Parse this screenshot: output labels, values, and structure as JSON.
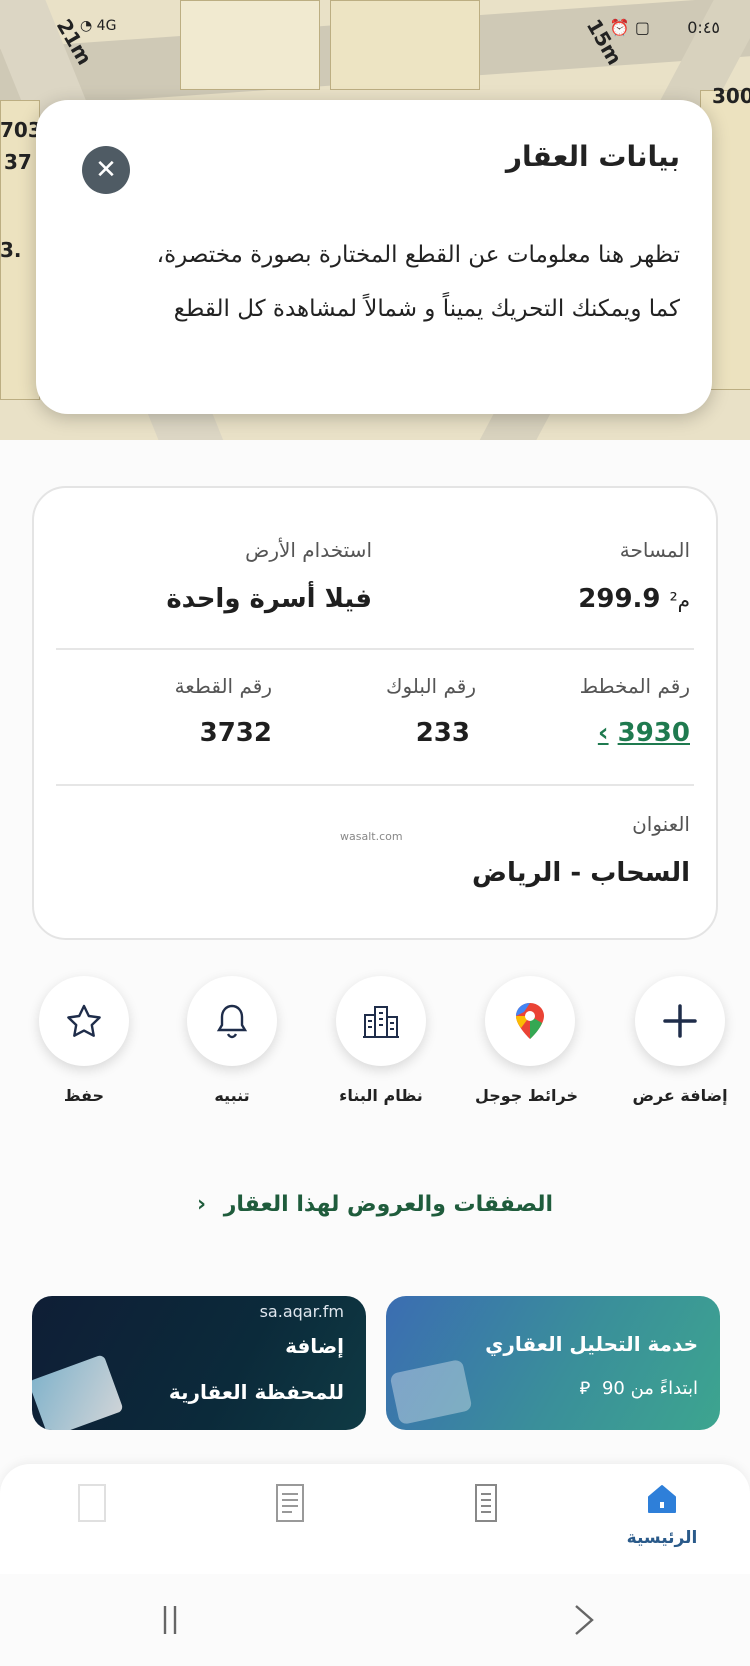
{
  "status_bar": {
    "time": "0:٤٥",
    "network": "4G"
  },
  "map": {
    "labels": [
      "21m",
      "15m",
      "37",
      "703",
      "3.",
      "300"
    ]
  },
  "tooltip": {
    "title": "بيانات العقار",
    "body": "تظهر هنا معلومات عن القطع المختارة بصورة مختصرة، كما ويمكنك التحريك يميناً و شمالاً لمشاهدة كل القطع",
    "close_icon": "close-icon"
  },
  "property": {
    "area_label": "المساحة",
    "area_value": "299.9",
    "area_unit": "م²",
    "land_use_label": "استخدام الأرض",
    "land_use_value": "فيلا أسرة واحدة",
    "plan_label": "رقم المخطط",
    "plan_value": "3930",
    "block_label": "رقم البلوك",
    "block_value": "233",
    "plot_label": "رقم القطعة",
    "plot_value": "3732",
    "address_label": "العنوان",
    "address_value": "السحاب - الرياض",
    "watermark": "wasalt.com"
  },
  "actions": [
    {
      "label": "إضافة عرض",
      "icon": "plus-icon"
    },
    {
      "label": "خرائط جوجل",
      "icon": "google-maps-icon"
    },
    {
      "label": "نظام البناء",
      "icon": "building-icon"
    },
    {
      "label": "تنبيه",
      "icon": "bell-icon"
    },
    {
      "label": "حفظ",
      "icon": "star-icon"
    }
  ],
  "deals_link": "الصفقات والعروض لهذا العقار",
  "banners": {
    "right_title": "خدمة التحليل العقاري",
    "right_subtitle": "ابتداءً من 90",
    "left_domain": "sa.aqar.fm",
    "left_line1": "إضافة",
    "left_line2": "للمحفظة العقارية"
  },
  "bottom_nav": {
    "home_label": "الرئيسية"
  },
  "colors": {
    "accent_green": "#1f7a4f",
    "nav_blue": "#2a5a8a",
    "home_icon": "#2e7fd9"
  }
}
